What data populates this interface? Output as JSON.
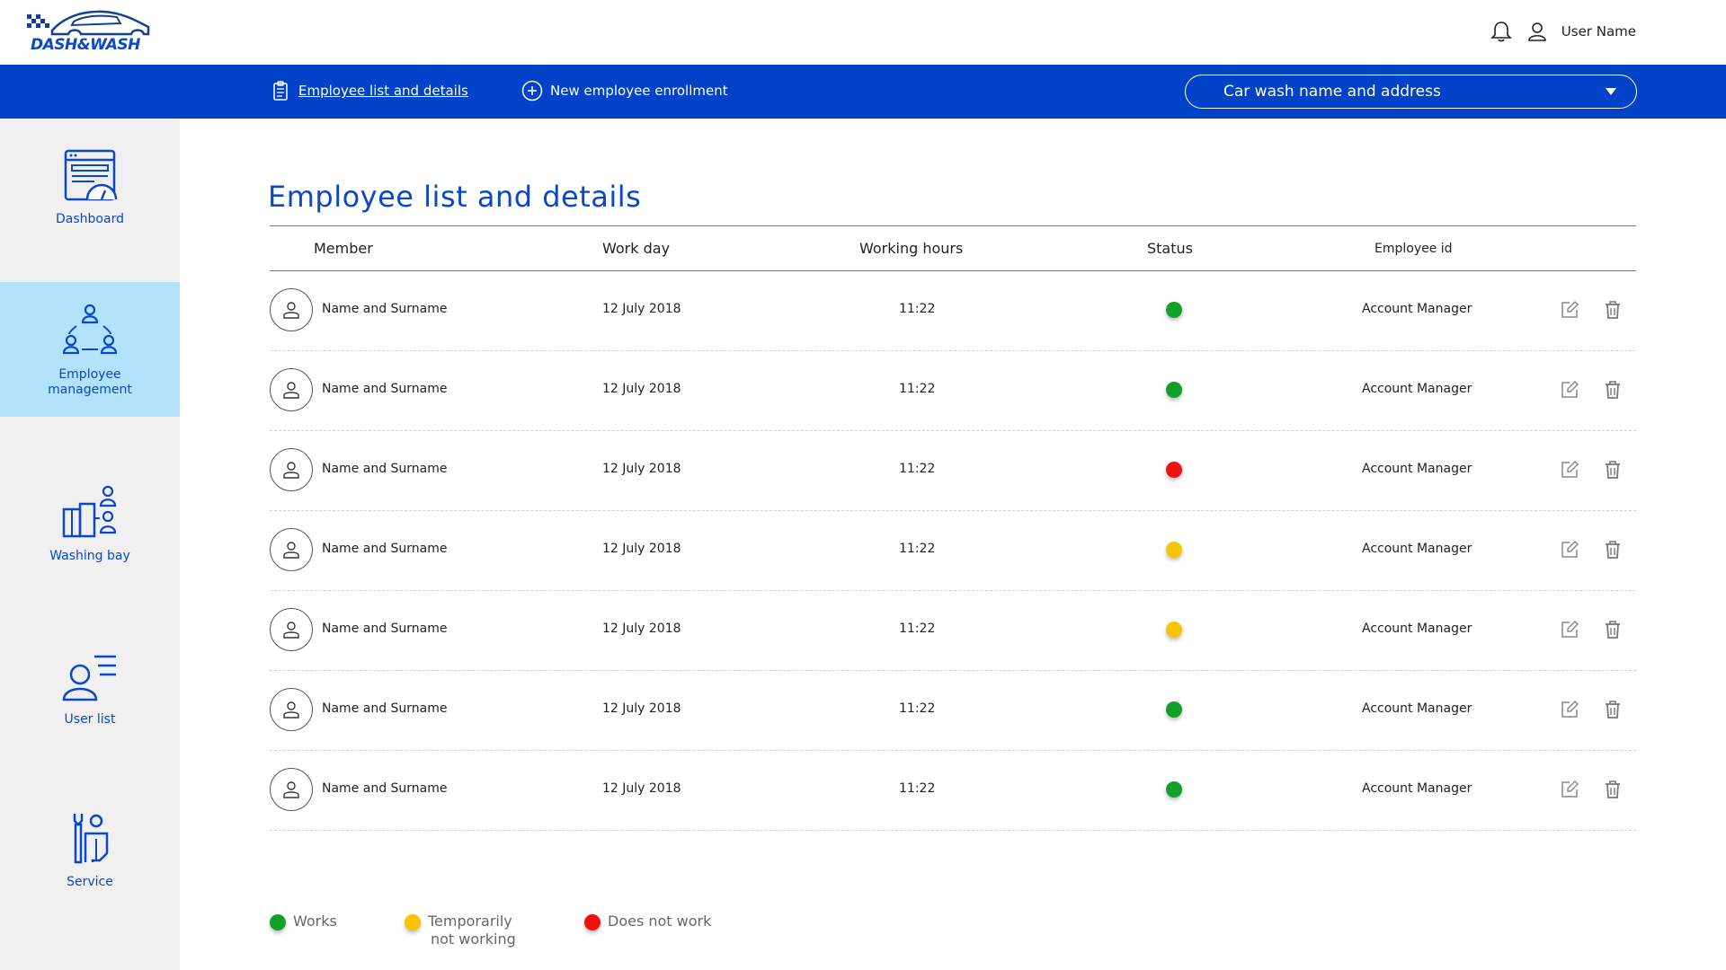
{
  "brand": {
    "logo_text": "DASH&WASH"
  },
  "header": {
    "user_name": "User Name"
  },
  "nav": {
    "tabs": [
      {
        "label": "Employee list and details",
        "active": true,
        "icon": "clipboard-icon"
      },
      {
        "label": "New employee enrollment",
        "active": false,
        "icon": "plus-circle-icon"
      }
    ],
    "carwash_select": {
      "value": "Car wash name and address"
    }
  },
  "sidebar": {
    "items": [
      {
        "label": "Dashboard",
        "icon": "dashboard-icon",
        "active": false
      },
      {
        "label": "Employee management",
        "icon": "team-icon",
        "active": true
      },
      {
        "label": "Washing bay",
        "icon": "washing-bay-icon",
        "active": false
      },
      {
        "label": "User list",
        "icon": "user-list-icon",
        "active": false
      },
      {
        "label": "Service",
        "icon": "service-icon",
        "active": false
      }
    ]
  },
  "main": {
    "title": "Employee list and details",
    "columns": [
      "Member",
      "Work day",
      "Working hours",
      "Status",
      "Employee id"
    ],
    "rows": [
      {
        "name": "Name and Surname",
        "work_day": "12 July 2018",
        "hours": "11:22",
        "status": "works",
        "employee_id": "Account Manager"
      },
      {
        "name": "Name and Surname",
        "work_day": "12 July 2018",
        "hours": "11:22",
        "status": "works",
        "employee_id": "Account Manager"
      },
      {
        "name": "Name and Surname",
        "work_day": "12 July 2018",
        "hours": "11:22",
        "status": "not_work",
        "employee_id": "Account Manager"
      },
      {
        "name": "Name and Surname",
        "work_day": "12 July 2018",
        "hours": "11:22",
        "status": "temp",
        "employee_id": "Account Manager"
      },
      {
        "name": "Name and Surname",
        "work_day": "12 July 2018",
        "hours": "11:22",
        "status": "temp",
        "employee_id": "Account Manager"
      },
      {
        "name": "Name and Surname",
        "work_day": "12 July 2018",
        "hours": "11:22",
        "status": "works",
        "employee_id": "Account Manager"
      },
      {
        "name": "Name and Surname",
        "work_day": "12 July 2018",
        "hours": "11:22",
        "status": "works",
        "employee_id": "Account Manager"
      }
    ]
  },
  "legend": {
    "works": "Works",
    "temp_line1": "Temporarily",
    "temp_line2": "not working",
    "not_work": "Does not work"
  },
  "colors": {
    "brand_blue": "#0043c8",
    "active_side": "#b3e3fc",
    "works": "#12a028",
    "temp": "#f7c500",
    "not_work": "#f01010"
  }
}
